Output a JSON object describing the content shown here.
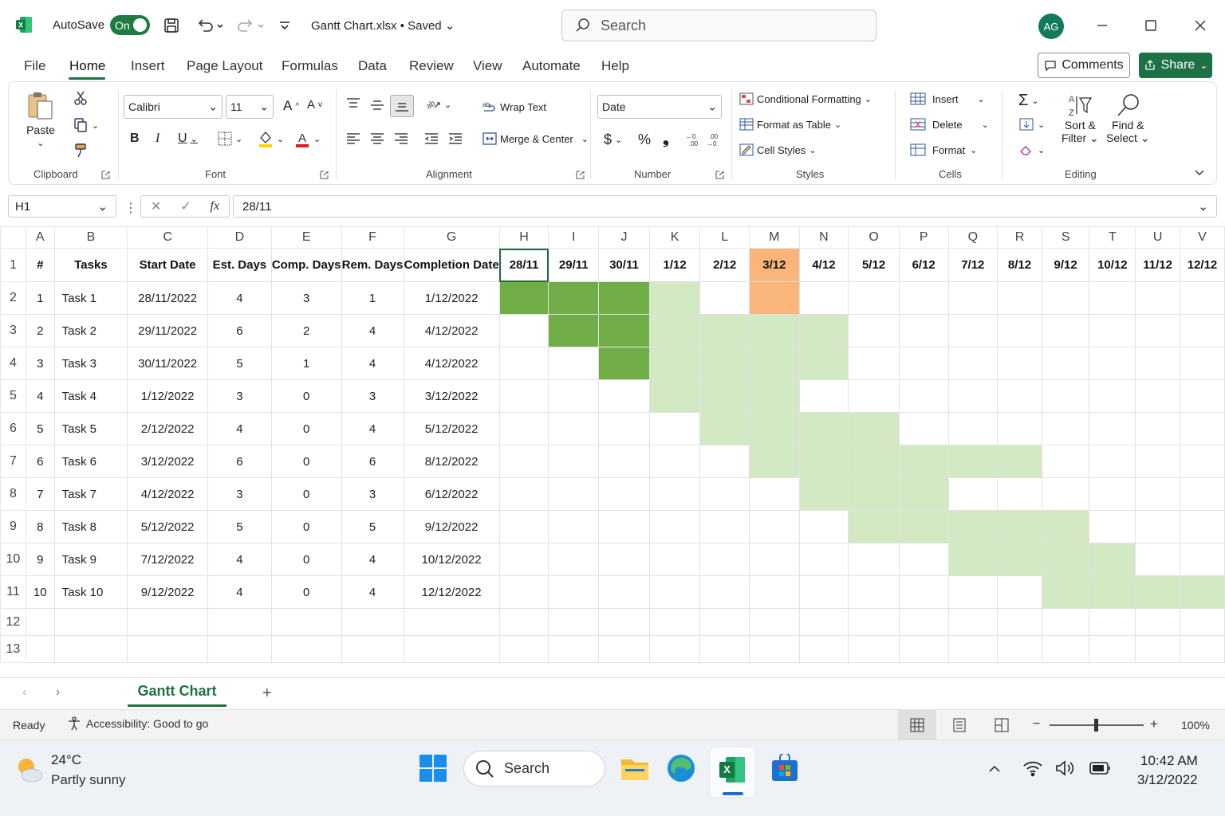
{
  "titlebar": {
    "autosave_label": "AutoSave",
    "autosave_state": "On",
    "doc_title": "Gantt Chart.xlsx • Saved",
    "search_placeholder": "Search",
    "avatar_initials": "AG"
  },
  "menu": {
    "items": [
      "File",
      "Home",
      "Insert",
      "Page Layout",
      "Formulas",
      "Data",
      "Review",
      "View",
      "Automate",
      "Help"
    ],
    "active": "Home",
    "comments_label": "Comments",
    "share_label": "Share"
  },
  "ribbon": {
    "clipboard": {
      "label": "Clipboard",
      "paste": "Paste"
    },
    "font": {
      "label": "Font",
      "font_name": "Calibri",
      "font_size": "11"
    },
    "alignment": {
      "label": "Alignment",
      "wrap_text": "Wrap Text",
      "merge_center": "Merge & Center"
    },
    "number": {
      "label": "Number",
      "format": "Date"
    },
    "styles": {
      "label": "Styles",
      "conditional": "Conditional Formatting",
      "format_table": "Format as Table",
      "cell_styles": "Cell Styles"
    },
    "cells": {
      "label": "Cells",
      "insert": "Insert",
      "delete": "Delete",
      "format": "Format"
    },
    "editing": {
      "label": "Editing",
      "sort_line1": "Sort &",
      "sort_line2": "Filter",
      "find_line1": "Find &",
      "find_line2": "Select"
    }
  },
  "formula_bar": {
    "name_box": "H1",
    "value": "28/11"
  },
  "sheet": {
    "columns": [
      "A",
      "B",
      "C",
      "D",
      "E",
      "F",
      "G",
      "H",
      "I",
      "J",
      "K",
      "L",
      "M",
      "N",
      "O",
      "P",
      "Q",
      "R",
      "S",
      "T",
      "U",
      "V"
    ],
    "headers": [
      "#",
      "Tasks",
      "Start Date",
      "Est. Days",
      "Comp. Days",
      "Rem. Days",
      "Completion Date"
    ],
    "dates": [
      "28/11",
      "29/11",
      "30/11",
      "1/12",
      "2/12",
      "3/12",
      "4/12",
      "5/12",
      "6/12",
      "7/12",
      "8/12",
      "9/12",
      "10/12",
      "11/12",
      "12/12"
    ],
    "today": "3/12",
    "tasks": [
      {
        "num": "1",
        "name": "Task 1",
        "start": "28/11/2022",
        "est": "4",
        "comp": "3",
        "rem": "1",
        "end": "1/12/2022",
        "start_idx": 0
      },
      {
        "num": "2",
        "name": "Task 2",
        "start": "29/11/2022",
        "est": "6",
        "comp": "2",
        "rem": "4",
        "end": "4/12/2022",
        "start_idx": 1
      },
      {
        "num": "3",
        "name": "Task 3",
        "start": "30/11/2022",
        "est": "5",
        "comp": "1",
        "rem": "4",
        "end": "4/12/2022",
        "start_idx": 2
      },
      {
        "num": "4",
        "name": "Task 4",
        "start": "1/12/2022",
        "est": "3",
        "comp": "0",
        "rem": "3",
        "end": "3/12/2022",
        "start_idx": 3
      },
      {
        "num": "5",
        "name": "Task 5",
        "start": "2/12/2022",
        "est": "4",
        "comp": "0",
        "rem": "4",
        "end": "5/12/2022",
        "start_idx": 4
      },
      {
        "num": "6",
        "name": "Task 6",
        "start": "3/12/2022",
        "est": "6",
        "comp": "0",
        "rem": "6",
        "end": "8/12/2022",
        "start_idx": 5
      },
      {
        "num": "7",
        "name": "Task 7",
        "start": "4/12/2022",
        "est": "3",
        "comp": "0",
        "rem": "3",
        "end": "6/12/2022",
        "start_idx": 6
      },
      {
        "num": "8",
        "name": "Task 8",
        "start": "5/12/2022",
        "est": "5",
        "comp": "0",
        "rem": "5",
        "end": "9/12/2022",
        "start_idx": 7
      },
      {
        "num": "9",
        "name": "Task 9",
        "start": "7/12/2022",
        "est": "4",
        "comp": "0",
        "rem": "4",
        "end": "10/12/2022",
        "start_idx": 9
      },
      {
        "num": "10",
        "name": "Task 10",
        "start": "9/12/2022",
        "est": "4",
        "comp": "0",
        "rem": "4",
        "end": "12/12/2022",
        "start_idx": 11
      }
    ],
    "row_numbers": [
      "1",
      "2",
      "3",
      "4",
      "5",
      "6",
      "7",
      "8",
      "9",
      "10",
      "11",
      "12",
      "13"
    ],
    "tab_name": "Gantt Chart",
    "colors": {
      "completed": "#70ad47",
      "remaining": "#d3e9c4",
      "today": "#f9b57a",
      "accent": "#1e7145"
    }
  },
  "statusbar": {
    "ready": "Ready",
    "accessibility": "Accessibility: Good to go",
    "zoom": "100%"
  },
  "taskbar": {
    "temperature": "24°C",
    "weather": "Partly sunny",
    "search": "Search",
    "time": "10:42 AM",
    "date": "3/12/2022"
  }
}
